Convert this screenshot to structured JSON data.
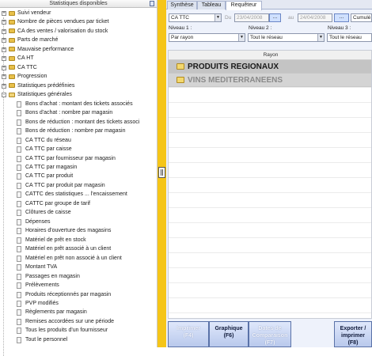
{
  "left_panel": {
    "title": "Statistiques disponibles",
    "folders": [
      {
        "label": "Suivi vendeur",
        "expander": "+"
      },
      {
        "label": "Nombre de pièces vendues par ticket",
        "expander": "+"
      },
      {
        "label": "CA des ventes / valorisation du stock",
        "expander": "+"
      },
      {
        "label": "Parts de marché",
        "expander": "+"
      },
      {
        "label": "Mauvaise performance",
        "expander": "+"
      },
      {
        "label": "CA HT",
        "expander": "+"
      },
      {
        "label": "CA TTC",
        "expander": "+"
      },
      {
        "label": "Progression",
        "expander": "+"
      },
      {
        "label": "Statistiques prédéfinies",
        "expander": "+"
      },
      {
        "label": "Statistiques générales",
        "expander": "-"
      }
    ],
    "items": [
      "Bons d'achat : montant des tickets associés",
      "Bons d'achat : nombre par magasin",
      "Bons de réduction : montant des tickets associ",
      "Bons de réduction : nombre par magasin",
      "CA TTC du réseau",
      "CA TTC par caisse",
      "CA TTC par fournisseur par magasin",
      "CA TTC par magasin",
      "CA TTC par produit",
      "CA TTC par produit par magasin",
      "CATTC des statistiques ... l'encaissement",
      "CATTC par groupe de tarif",
      "Clôtures de caisse",
      "Dépenses",
      "Horaires d'ouverture des magasins",
      "Matériel de prêt en stock",
      "Matériel en prêt associé à un client",
      "Matériel en prêt non associé à un client",
      "Montant TVA",
      "Passages en magasin",
      "Prélèvements",
      "Produits réceptionnés par magasin",
      "PVP modifiés",
      "Règlements par magasin",
      "Remises accordées sur une période",
      "Tous les produits d'un fournisseur",
      "Tout le personnel"
    ]
  },
  "tabs": [
    {
      "label": "Synthèse",
      "active": false
    },
    {
      "label": "Tableau",
      "active": false
    },
    {
      "label": "Requêteur",
      "active": true
    }
  ],
  "query": {
    "measure": "CA TTC",
    "from_label": "Du",
    "from_date": "23/04/2008",
    "to_label": "au",
    "to_date": "24/04/2008",
    "browse_label": "...",
    "cumul_label": "Cumulé",
    "level1_label": "Niveau 1 :",
    "level1_value": "Par rayon",
    "level2_label": "Niveau 2 :",
    "level2_value": "Tout le réseau",
    "level3_label": "Niveau 3 :",
    "level3_value": "Tout le réseau"
  },
  "grid": {
    "column_header": "Rayon",
    "rows": [
      {
        "label": "PRODUITS REGIONAUX",
        "background": "#c4c4c4",
        "color": "#1a1a1a"
      },
      {
        "label": "VINS MEDITERRANEENS",
        "background": "#d4d4d4",
        "color": "#8a8a8a"
      }
    ]
  },
  "footer": {
    "print": {
      "line1": "Imprimer",
      "line2": "(F4)"
    },
    "chart": {
      "line1": "Graphique",
      "line2": "(F6)"
    },
    "compare": {
      "line1": "Dates de",
      "line2": "Comparaison",
      "line3": "(F7)"
    },
    "export": {
      "line1": "Exporter /",
      "line2": "imprimer",
      "line3": "(F8)"
    }
  },
  "colors": {
    "splitter": "#f5c518",
    "panel_bg": "#eef2fb",
    "button_grad_top": "#dfe8fb",
    "button_grad_bottom": "#b9c9ec"
  }
}
